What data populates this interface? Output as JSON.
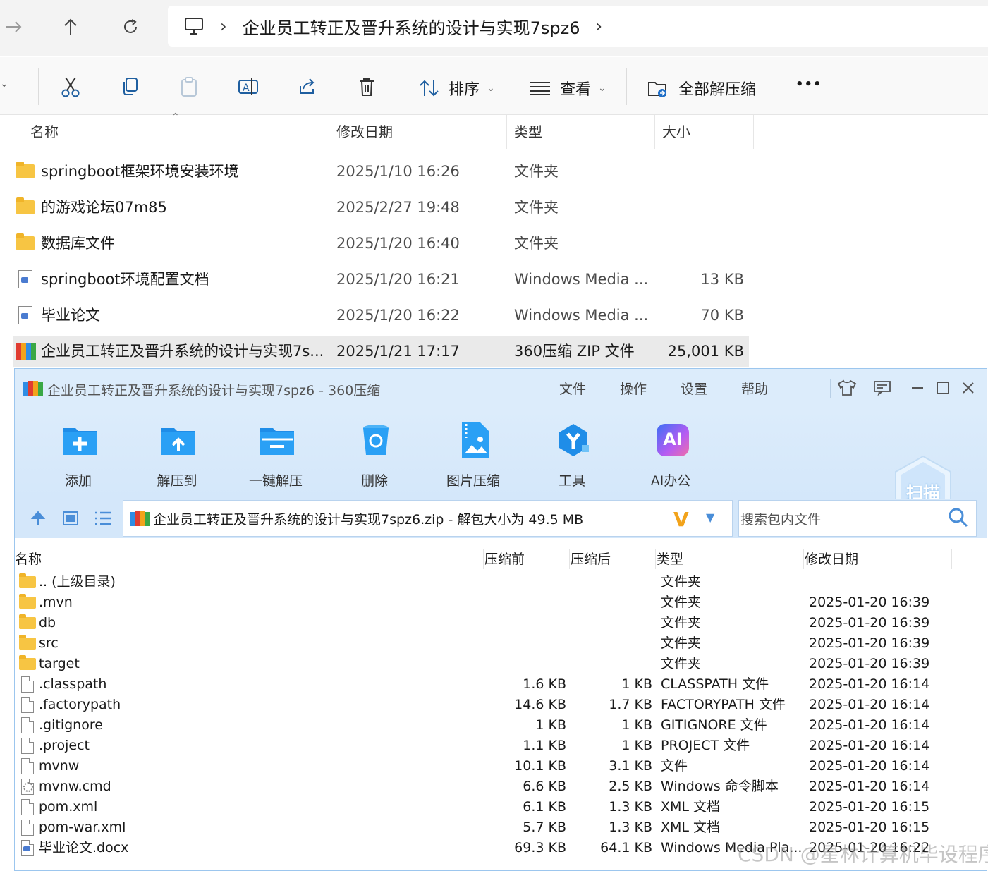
{
  "explorer": {
    "breadcrumb": "企业员工转正及晋升系统的设计与实现7spz6",
    "nav": {
      "forward_icon": "arrow-right-icon",
      "up_icon": "arrow-up-icon",
      "refresh_icon": "refresh-icon",
      "pc_icon": "computer-icon"
    },
    "commands": {
      "sort_label": "排序",
      "view_label": "查看",
      "extract_all_label": "全部解压缩",
      "more_label": "•••"
    },
    "columns": {
      "name": "名称",
      "date": "修改日期",
      "type": "类型",
      "size": "大小"
    },
    "rows": [
      {
        "icon": "folder-icon",
        "name": "springboot框架环境安装环境",
        "date": "2025/1/10 16:26",
        "type": "文件夹",
        "size": ""
      },
      {
        "icon": "folder-icon",
        "name": "的游戏论坛07m85",
        "date": "2025/2/27 19:48",
        "type": "文件夹",
        "size": ""
      },
      {
        "icon": "folder-icon",
        "name": "数据库文件",
        "date": "2025/1/20 16:40",
        "type": "文件夹",
        "size": ""
      },
      {
        "icon": "document-icon",
        "name": "springboot环境配置文档",
        "date": "2025/1/20 16:21",
        "type": "Windows Media ...",
        "size": "13 KB"
      },
      {
        "icon": "document-icon",
        "name": "毕业论文",
        "date": "2025/1/20 16:22",
        "type": "Windows Media ...",
        "size": "70 KB"
      },
      {
        "icon": "zip-archive-icon",
        "name": "企业员工转正及晋升系统的设计与实现7s...",
        "date": "2025/1/21 17:17",
        "type": "360压缩 ZIP 文件",
        "size": "25,001 KB"
      }
    ]
  },
  "zip_window": {
    "title": "企业员工转正及晋升系统的设计与实现7spz6 - 360压缩",
    "menu": [
      "文件",
      "操作",
      "设置",
      "帮助"
    ],
    "toolbar": [
      {
        "label": "添加",
        "icon": "add-folder-icon"
      },
      {
        "label": "解压到",
        "icon": "extract-to-folder-icon"
      },
      {
        "label": "一键解压",
        "icon": "one-click-extract-icon"
      },
      {
        "label": "删除",
        "icon": "recycle-bin-icon"
      },
      {
        "label": "图片压缩",
        "icon": "image-compress-icon"
      },
      {
        "label": "工具",
        "icon": "tools-icon"
      },
      {
        "label": "AI办公",
        "icon": "ai-office-icon"
      }
    ],
    "ai_badge": "AI",
    "scan_label": "扫描",
    "path_text": "企业员工转正及晋升系统的设计与实现7spz6.zip - 解包大小为 49.5 MB",
    "path_badge": "V",
    "search_placeholder": "搜索包内文件",
    "columns": {
      "name": "名称",
      "before": "压缩前",
      "after": "压缩后",
      "type": "类型",
      "date": "修改日期"
    },
    "files": [
      {
        "icon": "folder-icon",
        "name": ".. (上级目录)",
        "before": "",
        "after": "",
        "type": "文件夹",
        "date": ""
      },
      {
        "icon": "folder-icon",
        "name": ".mvn",
        "before": "",
        "after": "",
        "type": "文件夹",
        "date": "2025-01-20 16:39"
      },
      {
        "icon": "folder-icon",
        "name": "db",
        "before": "",
        "after": "",
        "type": "文件夹",
        "date": "2025-01-20 16:39"
      },
      {
        "icon": "folder-icon",
        "name": "src",
        "before": "",
        "after": "",
        "type": "文件夹",
        "date": "2025-01-20 16:39"
      },
      {
        "icon": "folder-icon",
        "name": "target",
        "before": "",
        "after": "",
        "type": "文件夹",
        "date": "2025-01-20 16:39"
      },
      {
        "icon": "file-icon",
        "name": ".classpath",
        "before": "1.6 KB",
        "after": "1 KB",
        "type": "CLASSPATH 文件",
        "date": "2025-01-20 16:14"
      },
      {
        "icon": "file-icon",
        "name": ".factorypath",
        "before": "14.6 KB",
        "after": "1.7 KB",
        "type": "FACTORYPATH 文件",
        "date": "2025-01-20 16:14"
      },
      {
        "icon": "file-icon",
        "name": ".gitignore",
        "before": "1 KB",
        "after": "1 KB",
        "type": "GITIGNORE 文件",
        "date": "2025-01-20 16:14"
      },
      {
        "icon": "file-icon",
        "name": ".project",
        "before": "1.1 KB",
        "after": "1 KB",
        "type": "PROJECT 文件",
        "date": "2025-01-20 16:14"
      },
      {
        "icon": "file-icon",
        "name": "mvnw",
        "before": "10.1 KB",
        "after": "3.1 KB",
        "type": "文件",
        "date": "2025-01-20 16:14"
      },
      {
        "icon": "cmd-file-icon",
        "name": "mvnw.cmd",
        "before": "6.6 KB",
        "after": "2.5 KB",
        "type": "Windows 命令脚本",
        "date": "2025-01-20 16:14"
      },
      {
        "icon": "file-icon",
        "name": "pom.xml",
        "before": "6.1 KB",
        "after": "1.3 KB",
        "type": "XML 文档",
        "date": "2025-01-20 16:15"
      },
      {
        "icon": "file-icon",
        "name": "pom-war.xml",
        "before": "5.7 KB",
        "after": "1.3 KB",
        "type": "XML 文档",
        "date": "2025-01-20 16:15"
      },
      {
        "icon": "docx-file-icon",
        "name": "毕业论文.docx",
        "before": "69.3 KB",
        "after": "64.1 KB",
        "type": "Windows Media Pla...",
        "date": "2025-01-20 16:22"
      }
    ]
  },
  "watermark": "CSDN @星林计算机毕设程序",
  "colors": {
    "zip_blue": "#2f8de4",
    "window_bg": "#dcecfb",
    "selected_row": "#eaeaea",
    "accent_orange": "#f2a31b"
  }
}
